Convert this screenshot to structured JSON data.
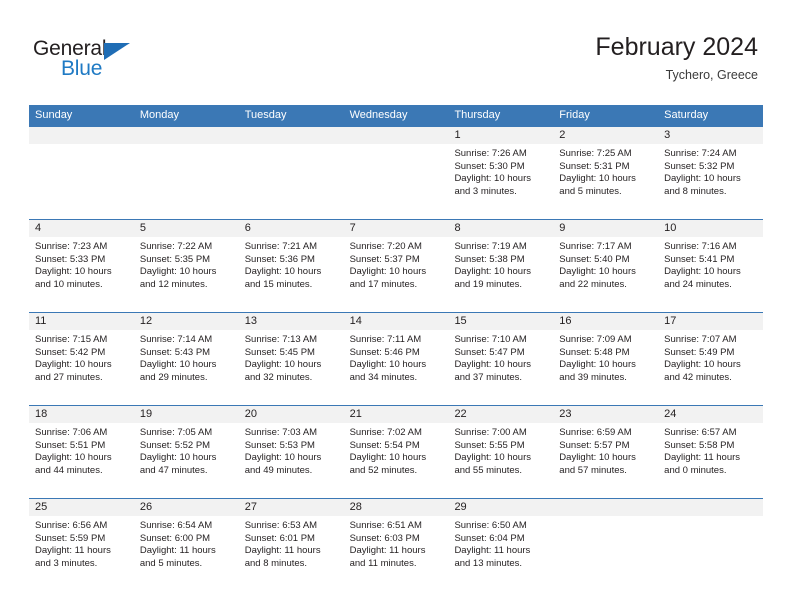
{
  "brand": {
    "name_part1": "General",
    "name_part2": "Blue",
    "logo_icon": "triangle-flag-icon"
  },
  "header": {
    "title": "February 2024",
    "subtitle": "Tychero, Greece"
  },
  "colors": {
    "header_blue": "#3b78b5",
    "logo_blue": "#1f7ac4",
    "day_band_gray": "#f2f2f2",
    "text": "#231f20"
  },
  "weekdays": [
    "Sunday",
    "Monday",
    "Tuesday",
    "Wednesday",
    "Thursday",
    "Friday",
    "Saturday"
  ],
  "weeks": [
    [
      {
        "empty": true
      },
      {
        "empty": true
      },
      {
        "empty": true
      },
      {
        "empty": true
      },
      {
        "date": "1",
        "sunrise": "Sunrise: 7:26 AM",
        "sunset": "Sunset: 5:30 PM",
        "daylight_line1": "Daylight: 10 hours",
        "daylight_line2": "and 3 minutes."
      },
      {
        "date": "2",
        "sunrise": "Sunrise: 7:25 AM",
        "sunset": "Sunset: 5:31 PM",
        "daylight_line1": "Daylight: 10 hours",
        "daylight_line2": "and 5 minutes."
      },
      {
        "date": "3",
        "sunrise": "Sunrise: 7:24 AM",
        "sunset": "Sunset: 5:32 PM",
        "daylight_line1": "Daylight: 10 hours",
        "daylight_line2": "and 8 minutes."
      }
    ],
    [
      {
        "date": "4",
        "sunrise": "Sunrise: 7:23 AM",
        "sunset": "Sunset: 5:33 PM",
        "daylight_line1": "Daylight: 10 hours",
        "daylight_line2": "and 10 minutes."
      },
      {
        "date": "5",
        "sunrise": "Sunrise: 7:22 AM",
        "sunset": "Sunset: 5:35 PM",
        "daylight_line1": "Daylight: 10 hours",
        "daylight_line2": "and 12 minutes."
      },
      {
        "date": "6",
        "sunrise": "Sunrise: 7:21 AM",
        "sunset": "Sunset: 5:36 PM",
        "daylight_line1": "Daylight: 10 hours",
        "daylight_line2": "and 15 minutes."
      },
      {
        "date": "7",
        "sunrise": "Sunrise: 7:20 AM",
        "sunset": "Sunset: 5:37 PM",
        "daylight_line1": "Daylight: 10 hours",
        "daylight_line2": "and 17 minutes."
      },
      {
        "date": "8",
        "sunrise": "Sunrise: 7:19 AM",
        "sunset": "Sunset: 5:38 PM",
        "daylight_line1": "Daylight: 10 hours",
        "daylight_line2": "and 19 minutes."
      },
      {
        "date": "9",
        "sunrise": "Sunrise: 7:17 AM",
        "sunset": "Sunset: 5:40 PM",
        "daylight_line1": "Daylight: 10 hours",
        "daylight_line2": "and 22 minutes."
      },
      {
        "date": "10",
        "sunrise": "Sunrise: 7:16 AM",
        "sunset": "Sunset: 5:41 PM",
        "daylight_line1": "Daylight: 10 hours",
        "daylight_line2": "and 24 minutes."
      }
    ],
    [
      {
        "date": "11",
        "sunrise": "Sunrise: 7:15 AM",
        "sunset": "Sunset: 5:42 PM",
        "daylight_line1": "Daylight: 10 hours",
        "daylight_line2": "and 27 minutes."
      },
      {
        "date": "12",
        "sunrise": "Sunrise: 7:14 AM",
        "sunset": "Sunset: 5:43 PM",
        "daylight_line1": "Daylight: 10 hours",
        "daylight_line2": "and 29 minutes."
      },
      {
        "date": "13",
        "sunrise": "Sunrise: 7:13 AM",
        "sunset": "Sunset: 5:45 PM",
        "daylight_line1": "Daylight: 10 hours",
        "daylight_line2": "and 32 minutes."
      },
      {
        "date": "14",
        "sunrise": "Sunrise: 7:11 AM",
        "sunset": "Sunset: 5:46 PM",
        "daylight_line1": "Daylight: 10 hours",
        "daylight_line2": "and 34 minutes."
      },
      {
        "date": "15",
        "sunrise": "Sunrise: 7:10 AM",
        "sunset": "Sunset: 5:47 PM",
        "daylight_line1": "Daylight: 10 hours",
        "daylight_line2": "and 37 minutes."
      },
      {
        "date": "16",
        "sunrise": "Sunrise: 7:09 AM",
        "sunset": "Sunset: 5:48 PM",
        "daylight_line1": "Daylight: 10 hours",
        "daylight_line2": "and 39 minutes."
      },
      {
        "date": "17",
        "sunrise": "Sunrise: 7:07 AM",
        "sunset": "Sunset: 5:49 PM",
        "daylight_line1": "Daylight: 10 hours",
        "daylight_line2": "and 42 minutes."
      }
    ],
    [
      {
        "date": "18",
        "sunrise": "Sunrise: 7:06 AM",
        "sunset": "Sunset: 5:51 PM",
        "daylight_line1": "Daylight: 10 hours",
        "daylight_line2": "and 44 minutes."
      },
      {
        "date": "19",
        "sunrise": "Sunrise: 7:05 AM",
        "sunset": "Sunset: 5:52 PM",
        "daylight_line1": "Daylight: 10 hours",
        "daylight_line2": "and 47 minutes."
      },
      {
        "date": "20",
        "sunrise": "Sunrise: 7:03 AM",
        "sunset": "Sunset: 5:53 PM",
        "daylight_line1": "Daylight: 10 hours",
        "daylight_line2": "and 49 minutes."
      },
      {
        "date": "21",
        "sunrise": "Sunrise: 7:02 AM",
        "sunset": "Sunset: 5:54 PM",
        "daylight_line1": "Daylight: 10 hours",
        "daylight_line2": "and 52 minutes."
      },
      {
        "date": "22",
        "sunrise": "Sunrise: 7:00 AM",
        "sunset": "Sunset: 5:55 PM",
        "daylight_line1": "Daylight: 10 hours",
        "daylight_line2": "and 55 minutes."
      },
      {
        "date": "23",
        "sunrise": "Sunrise: 6:59 AM",
        "sunset": "Sunset: 5:57 PM",
        "daylight_line1": "Daylight: 10 hours",
        "daylight_line2": "and 57 minutes."
      },
      {
        "date": "24",
        "sunrise": "Sunrise: 6:57 AM",
        "sunset": "Sunset: 5:58 PM",
        "daylight_line1": "Daylight: 11 hours",
        "daylight_line2": "and 0 minutes."
      }
    ],
    [
      {
        "date": "25",
        "sunrise": "Sunrise: 6:56 AM",
        "sunset": "Sunset: 5:59 PM",
        "daylight_line1": "Daylight: 11 hours",
        "daylight_line2": "and 3 minutes."
      },
      {
        "date": "26",
        "sunrise": "Sunrise: 6:54 AM",
        "sunset": "Sunset: 6:00 PM",
        "daylight_line1": "Daylight: 11 hours",
        "daylight_line2": "and 5 minutes."
      },
      {
        "date": "27",
        "sunrise": "Sunrise: 6:53 AM",
        "sunset": "Sunset: 6:01 PM",
        "daylight_line1": "Daylight: 11 hours",
        "daylight_line2": "and 8 minutes."
      },
      {
        "date": "28",
        "sunrise": "Sunrise: 6:51 AM",
        "sunset": "Sunset: 6:03 PM",
        "daylight_line1": "Daylight: 11 hours",
        "daylight_line2": "and 11 minutes."
      },
      {
        "date": "29",
        "sunrise": "Sunrise: 6:50 AM",
        "sunset": "Sunset: 6:04 PM",
        "daylight_line1": "Daylight: 11 hours",
        "daylight_line2": "and 13 minutes."
      },
      {
        "empty": true
      },
      {
        "empty": true
      }
    ]
  ]
}
